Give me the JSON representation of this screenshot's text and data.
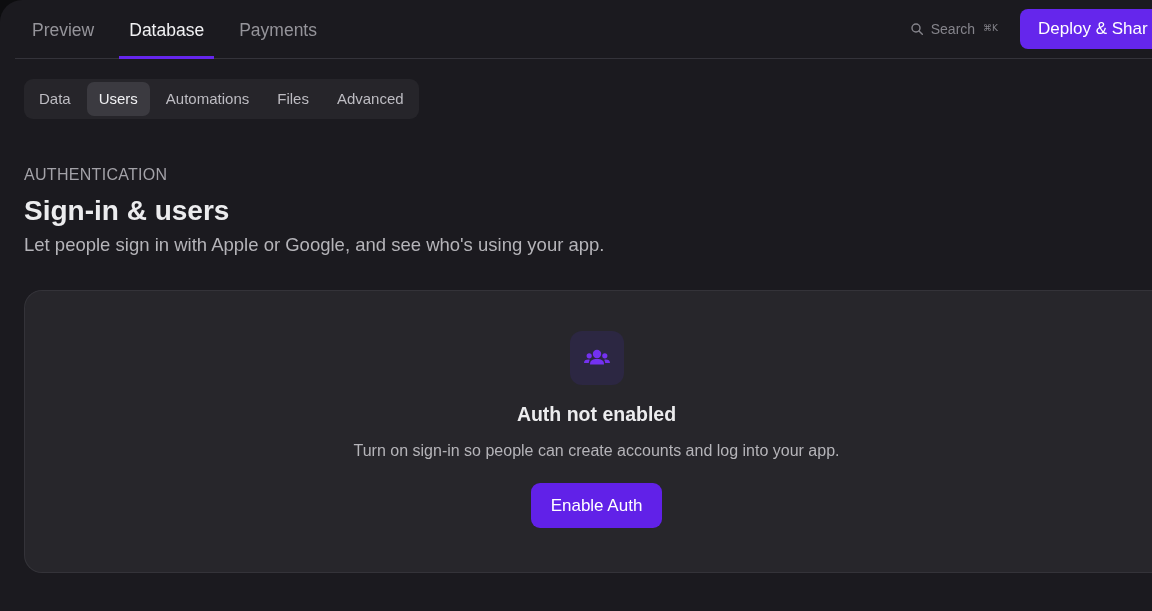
{
  "top_tabs": [
    {
      "label": "Preview",
      "selected": false
    },
    {
      "label": "Database",
      "selected": true
    },
    {
      "label": "Payments",
      "selected": false
    }
  ],
  "search": {
    "label": "Search",
    "shortcut": "⌘K"
  },
  "deploy_button": {
    "label": "Deploy & Shar"
  },
  "sub_tabs": [
    {
      "label": "Data",
      "selected": false
    },
    {
      "label": "Users",
      "selected": true
    },
    {
      "label": "Automations",
      "selected": false
    },
    {
      "label": "Files",
      "selected": false
    },
    {
      "label": "Advanced",
      "selected": false
    }
  ],
  "section": {
    "eyebrow": "AUTHENTICATION",
    "title": "Sign-in & users",
    "description": "Let people sign in with Apple or Google, and see who's using your app."
  },
  "empty_state": {
    "title": "Auth not enabled",
    "description": "Turn on sign-in so people can create accounts and log into your app.",
    "button": "Enable Auth"
  }
}
